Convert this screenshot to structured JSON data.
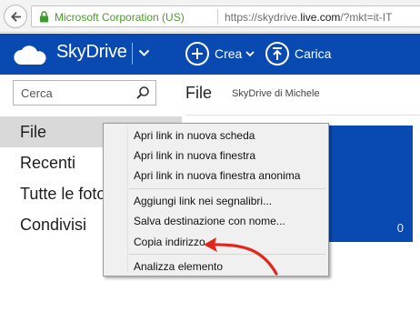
{
  "browser": {
    "identity_label": "Microsoft Corporation (US)",
    "url_prefix": "https://skydrive.",
    "url_domain": "live.com",
    "url_suffix": "/?mkt=it-IT"
  },
  "appbar": {
    "brand": "SkyDrive",
    "create_label": "Crea",
    "upload_label": "Carica",
    "colors": {
      "bar": "#094ab2",
      "identity_green": "#4b9b2c"
    }
  },
  "sidebar": {
    "search_placeholder": "Cerca",
    "items": [
      {
        "label": "File",
        "active": true
      },
      {
        "label": "Recenti",
        "active": false
      },
      {
        "label": "Tutte le foto",
        "active": false
      },
      {
        "label": "Condivisi",
        "active": false
      }
    ]
  },
  "main": {
    "title": "File",
    "owner": "SkyDrive di Michele",
    "tile_count": "0"
  },
  "context_menu": {
    "items": [
      {
        "label": "Apri link in nuova scheda"
      },
      {
        "label": "Apri link in nuova finestra"
      },
      {
        "label": "Apri link in nuova finestra anonima"
      },
      {
        "label": "Aggiungi link nei segnalibri..."
      },
      {
        "label": "Salva destinazione con nome..."
      },
      {
        "label": "Copia indirizzo"
      },
      {
        "label": "Analizza elemento"
      }
    ]
  },
  "annotation": {
    "arrow_color": "#e3261b",
    "points_to": "Copia indirizzo"
  }
}
